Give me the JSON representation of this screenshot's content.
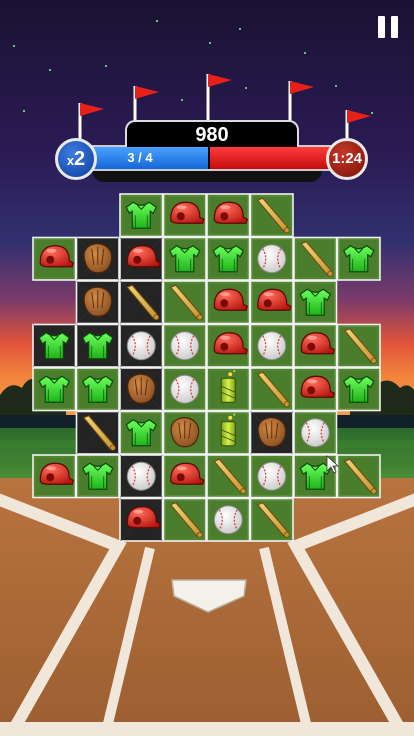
{
  "hud": {
    "score": "980",
    "progress_text": "3 / 4",
    "progress": 0.75,
    "multiplier_prefix": "x",
    "multiplier_value": "2",
    "timer": "1:24"
  },
  "colors": {
    "team_blue": "#1565d8",
    "team_red": "#c50d0d",
    "tile_green": "#4a7d2c",
    "tile_dark": "#242424"
  },
  "board": {
    "rows": [
      [
        "",
        "",
        "jersey",
        "helmet",
        "helmet",
        "bat",
        "",
        ""
      ],
      [
        "helmet",
        "glove",
        "helmet",
        "jersey",
        "jersey",
        "ball",
        "bat",
        "jersey"
      ],
      [
        "",
        "glove",
        "bat",
        "bat",
        "helmet",
        "helmet",
        "jersey",
        ""
      ],
      [
        "jersey",
        "jersey",
        "ball",
        "ball",
        "helmet",
        "ball",
        "helmet",
        "bat"
      ],
      [
        "jersey",
        "jersey",
        "glove",
        "ball",
        "firework",
        "bat",
        "helmet",
        "jersey"
      ],
      [
        "",
        "bat",
        "jersey",
        "glove",
        "firework",
        "glove",
        "ball",
        ""
      ],
      [
        "helmet",
        "jersey",
        "ball",
        "helmet",
        "bat",
        "ball",
        "jersey",
        "bat"
      ],
      [
        "",
        "",
        "helmet",
        "bat",
        "ball",
        "bat",
        "",
        ""
      ]
    ],
    "tile_style": [
      [
        "",
        "",
        "green",
        "green",
        "green",
        "green",
        "",
        ""
      ],
      [
        "green",
        "dark",
        "dark",
        "green",
        "green",
        "green",
        "green",
        "green"
      ],
      [
        "",
        "dark",
        "dark",
        "green",
        "green",
        "green",
        "green",
        ""
      ],
      [
        "dark",
        "dark",
        "dark",
        "green",
        "green",
        "green",
        "green",
        "green"
      ],
      [
        "green",
        "green",
        "dark",
        "green",
        "green",
        "green",
        "green",
        "green"
      ],
      [
        "",
        "dark",
        "green",
        "green",
        "green",
        "dark",
        "green",
        ""
      ],
      [
        "green",
        "green",
        "dark",
        "green",
        "green",
        "green",
        "green",
        "green"
      ],
      [
        "",
        "",
        "dark",
        "green",
        "green",
        "green",
        "",
        ""
      ]
    ]
  }
}
